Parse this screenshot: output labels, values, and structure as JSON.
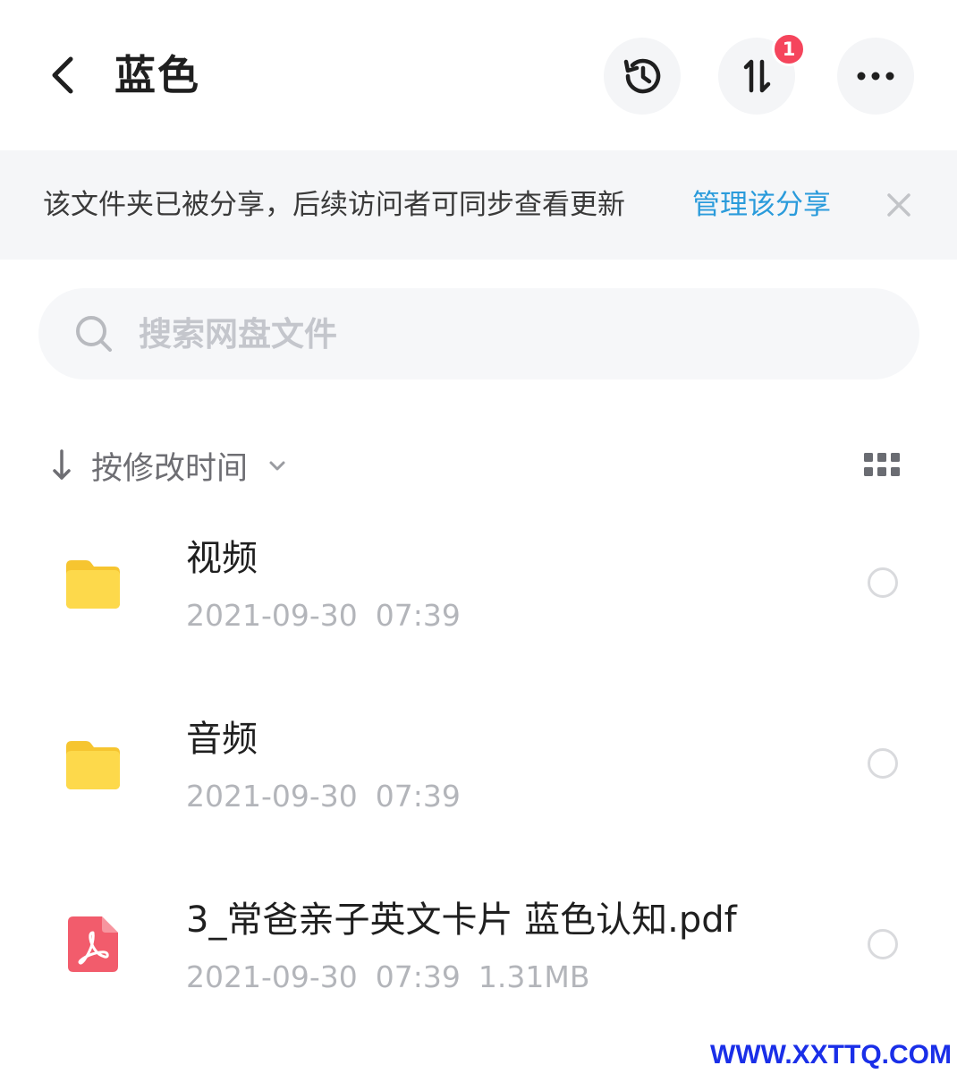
{
  "header": {
    "title": "蓝色",
    "transfer_badge": "1"
  },
  "notice": {
    "text": "该文件夹已被分享，后续访问者可同步查看更新",
    "link": "管理该分享"
  },
  "search": {
    "placeholder": "搜索网盘文件"
  },
  "sort": {
    "label": "按修改时间"
  },
  "files": [
    {
      "name": "视频",
      "date": "2021-09-30",
      "time": "07:39",
      "size": "",
      "type": "folder"
    },
    {
      "name": "音频",
      "date": "2021-09-30",
      "time": "07:39",
      "size": "",
      "type": "folder"
    },
    {
      "name": "3_常爸亲子英文卡片 蓝色认知.pdf",
      "date": "2021-09-30",
      "time": "07:39",
      "size": "1.31MB",
      "type": "pdf"
    }
  ],
  "watermark": "WWW.XXTTQ.COM",
  "colors": {
    "folder": "#fdd94b",
    "folder_tab": "#f6c530",
    "pdf": "#f25c6c",
    "link": "#2a9bdb",
    "badge": "#f5455c"
  },
  "icons": {
    "back": "chevron-left-icon",
    "history": "history-icon",
    "transfer": "transfer-icon",
    "more": "more-dots-icon",
    "close": "close-icon",
    "search": "search-icon",
    "sort": "arrow-down-icon",
    "grid": "grid-view-icon"
  }
}
